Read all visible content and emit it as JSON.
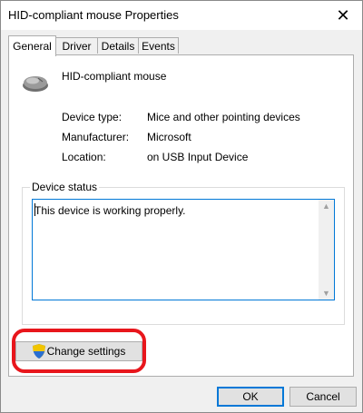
{
  "window": {
    "title": "HID-compliant mouse Properties",
    "close_glyph": "✕"
  },
  "tabs": [
    {
      "label": "General",
      "active": true
    },
    {
      "label": "Driver",
      "active": false
    },
    {
      "label": "Details",
      "active": false
    },
    {
      "label": "Events",
      "active": false
    }
  ],
  "device": {
    "name": "HID-compliant mouse",
    "icon": "mouse-icon",
    "properties": [
      {
        "label": "Device type:",
        "value": "Mice and other pointing devices"
      },
      {
        "label": "Manufacturer:",
        "value": "Microsoft"
      },
      {
        "label": "Location:",
        "value": "on USB Input Device"
      }
    ]
  },
  "status": {
    "group_label": "Device status",
    "text": "This device is working properly.",
    "scroll_up": "▲",
    "scroll_down": "▼"
  },
  "buttons": {
    "change_settings": "Change settings",
    "change_settings_icon": "uac-shield-icon",
    "ok": "OK",
    "cancel": "Cancel"
  },
  "colors": {
    "accent": "#0078d7",
    "highlight": "#e8161c"
  }
}
